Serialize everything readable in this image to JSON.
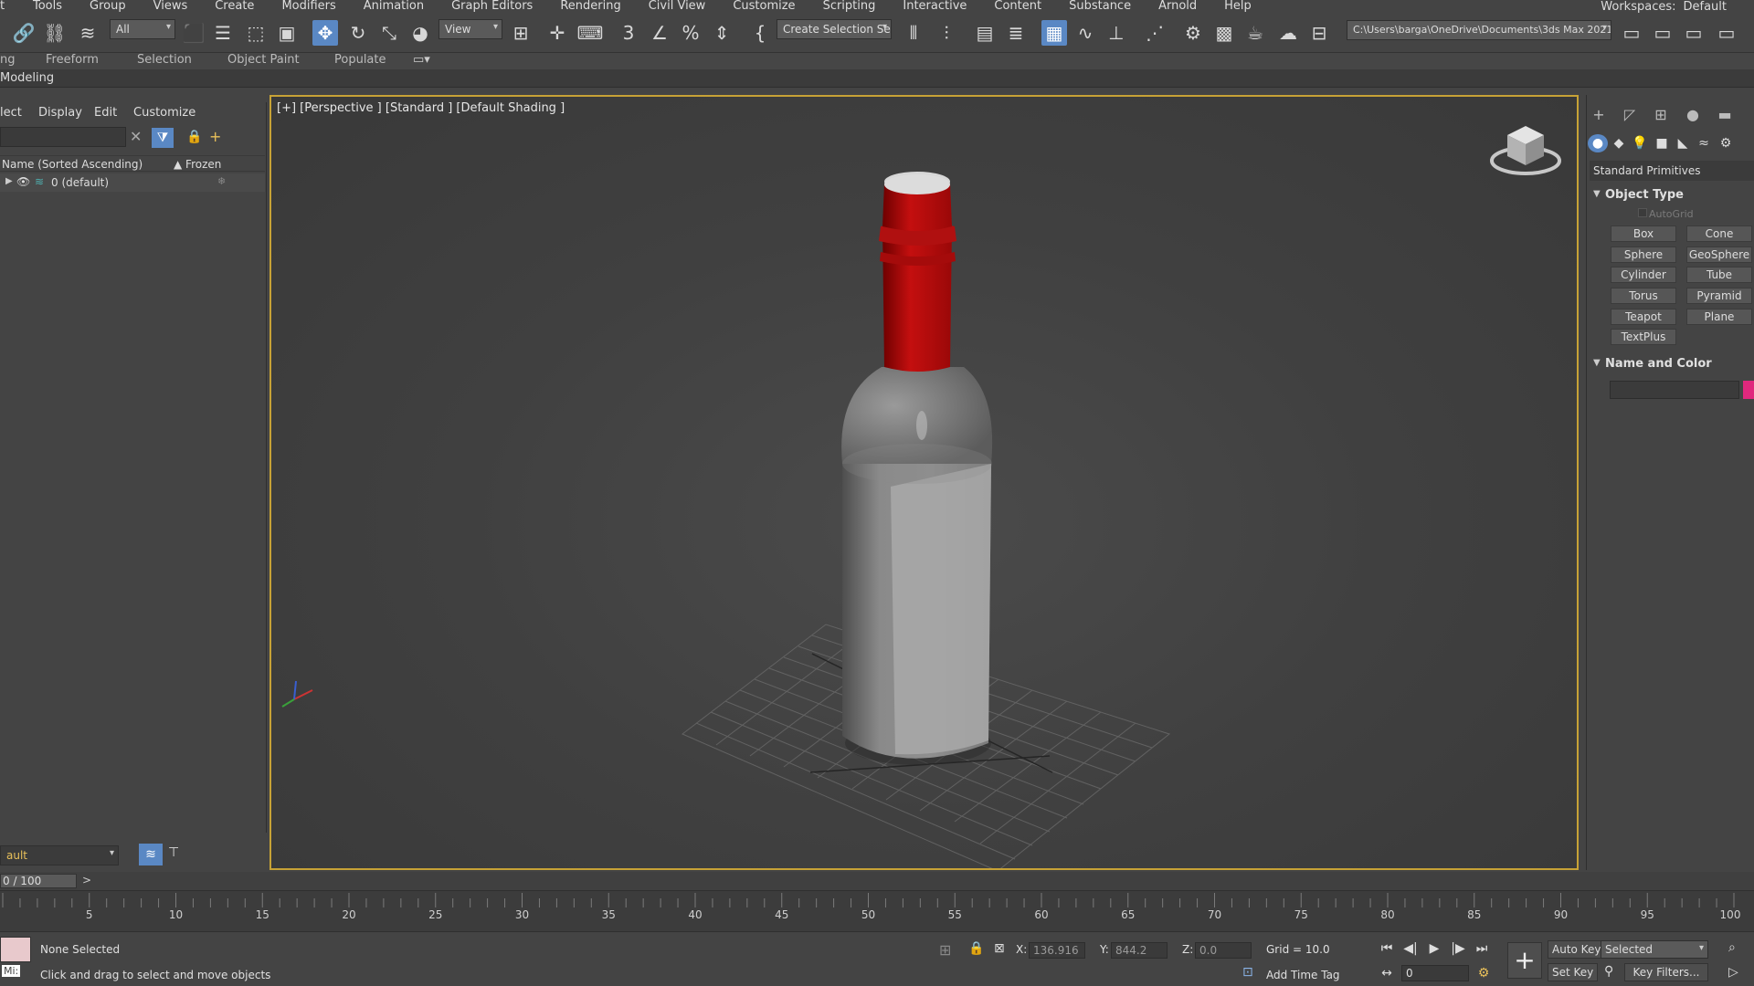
{
  "menu": {
    "items": [
      "t",
      "Tools",
      "Group",
      "Views",
      "Create",
      "Modifiers",
      "Animation",
      "Graph Editors",
      "Rendering",
      "Civil View",
      "Customize",
      "Scripting",
      "Interactive",
      "Content",
      "Substance",
      "Arnold",
      "Help"
    ],
    "workspaces_label": "Workspaces:",
    "workspace_value": "Default"
  },
  "toolbar": {
    "filter_value": "All",
    "ref_coord_value": "View",
    "selection_set_value": "Create Selection Se",
    "project_path": "C:\\Users\\barga\\OneDrive\\Documents\\3ds Max 2021"
  },
  "ribbon": {
    "tabs": [
      "ng",
      "Freeform",
      "Selection",
      "Object Paint",
      "Populate"
    ],
    "sub_label": "Modeling"
  },
  "scene_explorer": {
    "menu": [
      "lect",
      "Display",
      "Edit",
      "Customize"
    ],
    "col_name": "Name (Sorted Ascending)",
    "col_frozen": "▲ Frozen",
    "rows": [
      {
        "name": "0 (default)"
      }
    ],
    "layer_dropdown": "ault"
  },
  "viewport": {
    "label": "[+] [Perspective ] [Standard ] [Default Shading ]"
  },
  "command_panel": {
    "category_value": "Standard Primitives",
    "object_type_title": "Object Type",
    "autogrid_label": "AutoGrid",
    "primitives": [
      "Box",
      "Cone",
      "Sphere",
      "GeoSphere",
      "Cylinder",
      "Tube",
      "Torus",
      "Pyramid",
      "Teapot",
      "Plane",
      "TextPlus"
    ],
    "name_color_title": "Name and Color",
    "object_color": "#e0287d"
  },
  "timeline": {
    "frame_display": "0 / 100",
    "next_label": ">",
    "ticks": [
      "5",
      "10",
      "15",
      "20",
      "25",
      "30",
      "35",
      "40",
      "45",
      "50",
      "55",
      "60",
      "65",
      "70",
      "75",
      "80",
      "85",
      "90",
      "95",
      "100"
    ]
  },
  "status": {
    "selection": "None Selected",
    "prompt": "Click and drag to select and move objects",
    "x_label": "X:",
    "x_value": "136.916",
    "y_label": "Y:",
    "y_value": "844.2",
    "z_label": "Z:",
    "z_value": "0.0",
    "grid": "Grid = 10.0",
    "add_time_tag": "Add Time Tag",
    "auto_key": "Auto Key",
    "key_mode_value": "Selected",
    "set_key": "Set Key",
    "key_filters": "Key Filters...",
    "frame_value": "0",
    "maxscript_label": "Mi:"
  },
  "colors": {
    "accent": "#5a88c4",
    "viewport_border": "#c7a236",
    "bottle_cap": "#c40f0f"
  }
}
